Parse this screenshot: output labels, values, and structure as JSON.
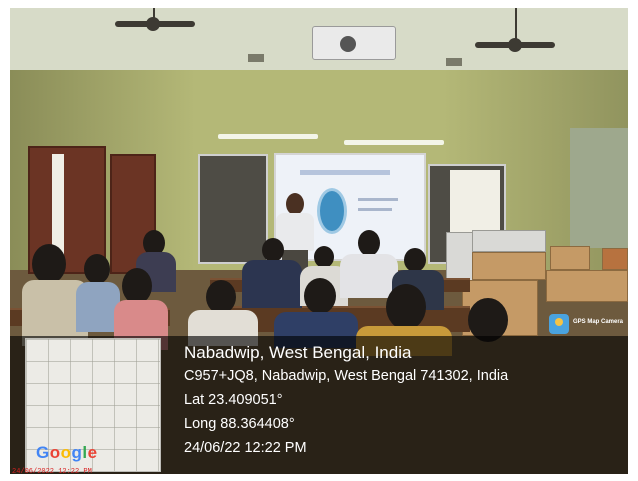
{
  "photo": {
    "description_icon": "classroom-photo"
  },
  "gps_badge": {
    "label": "GPS Map Camera",
    "icon": "map-pin-icon"
  },
  "map": {
    "brand_letters": [
      "G",
      "o",
      "o",
      "g",
      "l",
      "e"
    ]
  },
  "location": {
    "title": "Nabadwip, West Bengal, India",
    "address": "C957+JQ8, Nabadwip, West Bengal 741302, India",
    "latitude": "Lat 23.409051°",
    "longitude": "Long 88.364408°",
    "datetime": "24/06/22 12:22 PM"
  },
  "stamp": {
    "text": "24/06/2022 12:22 PM"
  },
  "colors": {
    "overlay": "#000000",
    "google_blue": "#4285f4",
    "google_red": "#ea4335",
    "google_yellow": "#fbbc05",
    "google_green": "#34a853",
    "stamp_red": "#d82020"
  }
}
